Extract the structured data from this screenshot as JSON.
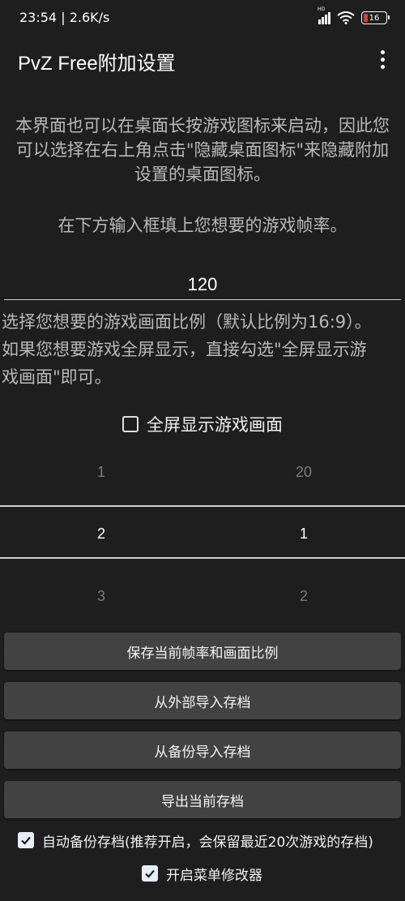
{
  "status": {
    "time": "23:54",
    "speed": "2.6K/s",
    "network_badge": "HD",
    "battery_level": "16",
    "battery_color": "#e53935"
  },
  "appbar": {
    "title": "PvZ Free附加设置",
    "menu_icon": "more-vert-icon"
  },
  "intro": {
    "line1": "本界面也可以在桌面长按游戏图标来启动，因此您",
    "line2": "可以选择在右上角点击\"隐藏桌面图标\"来隐藏附加",
    "line3": "设置的桌面图标。"
  },
  "hint": "在下方输入框填上您想要的游戏帧率。",
  "fps_input": {
    "value": "120"
  },
  "ratio_desc": {
    "line1": "选择您想要的游戏画面比例（默认比例为16:9）。",
    "line2": "如果您想要游戏全屏显示，直接勾选\"全屏显示游",
    "line3": "戏画面\"即可。"
  },
  "fullscreen": {
    "label": "全屏显示游戏画面",
    "checked": false
  },
  "ratio_picker": {
    "left": {
      "above": "1",
      "selected": "2",
      "below": "3"
    },
    "right": {
      "above": "20",
      "selected": "1",
      "below": "2"
    }
  },
  "buttons": {
    "save": "保存当前帧率和画面比例",
    "import_external": "从外部导入存档",
    "import_backup": "从备份导入存档",
    "export": "导出当前存档"
  },
  "options": {
    "auto_backup": {
      "label": "自动备份存档(推荐开启，会保留最近20次游戏的存档)",
      "checked": true
    },
    "menu_modifier": {
      "label": "开启菜单修改器",
      "checked": true
    }
  }
}
